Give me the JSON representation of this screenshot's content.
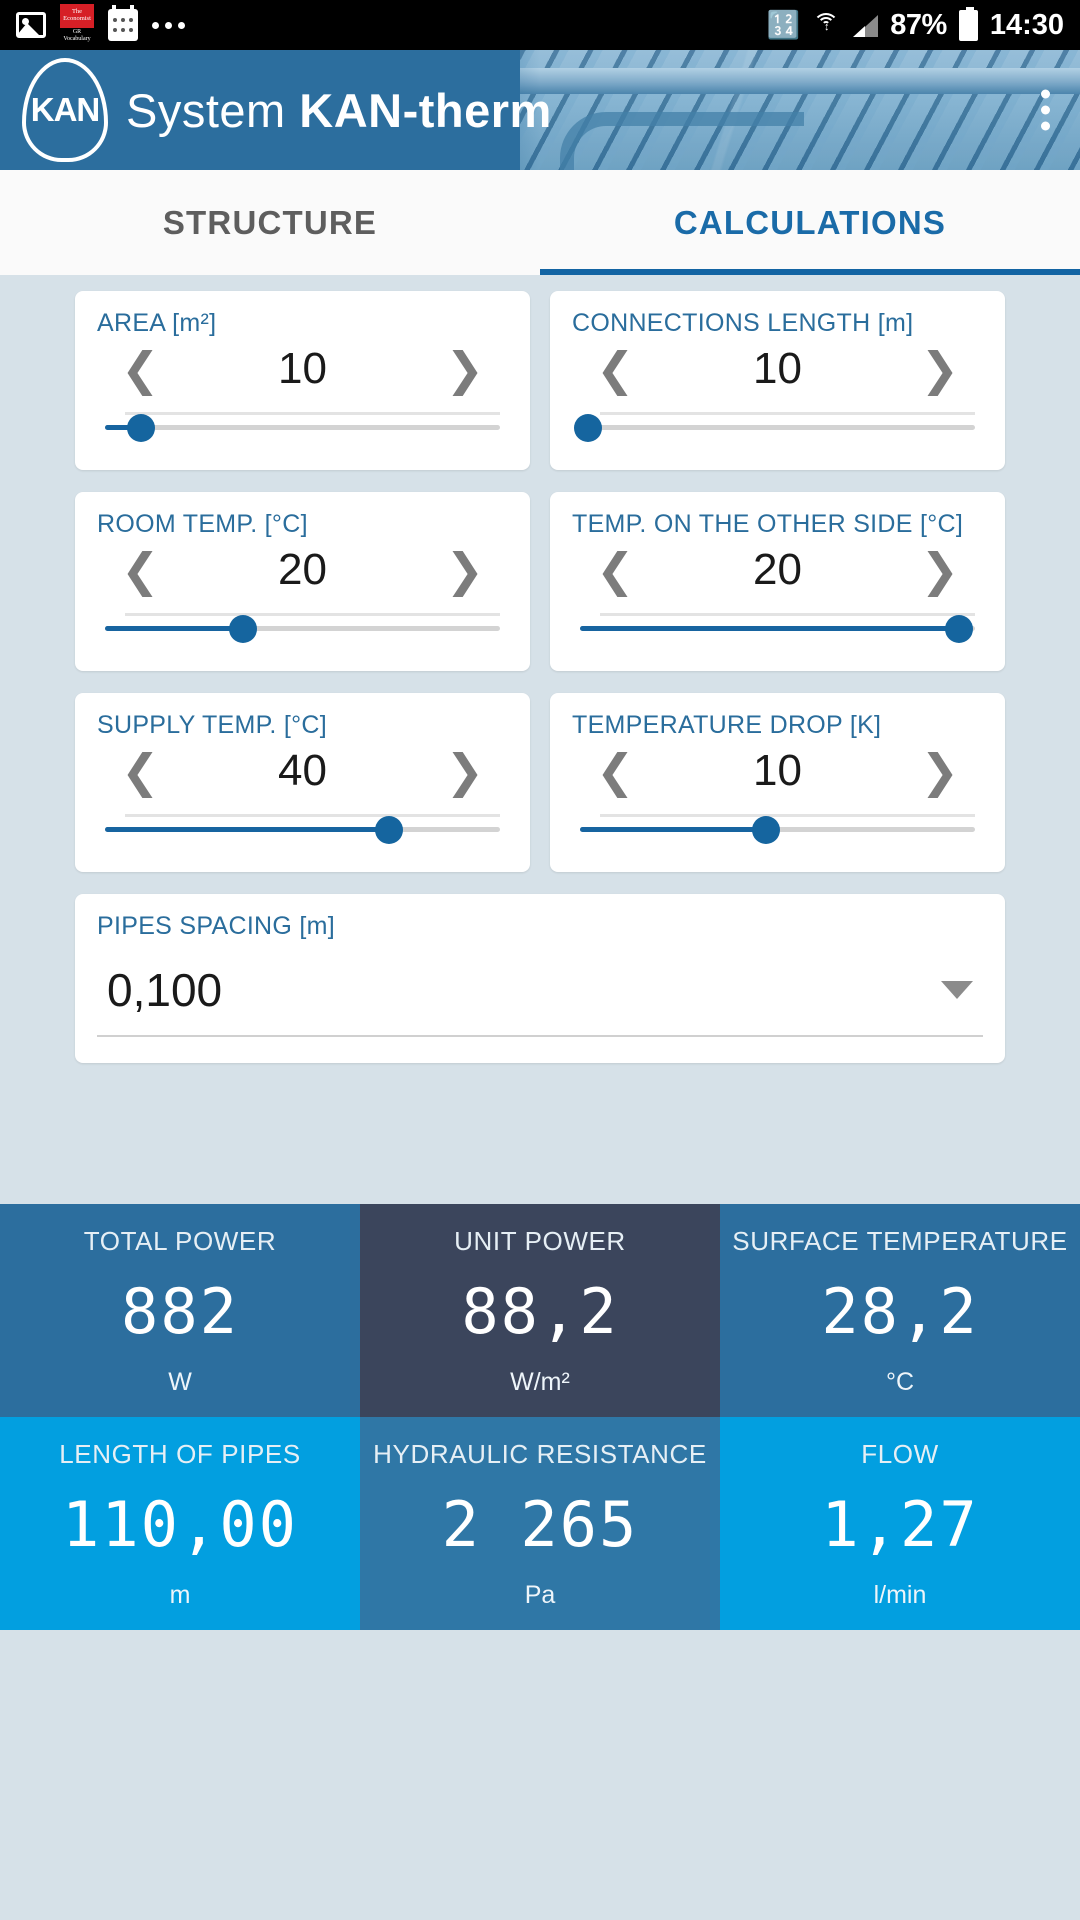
{
  "statusbar": {
    "notifications": [
      {
        "icon": "gallery-icon"
      },
      {
        "icon": "economist-icon",
        "line1": "The",
        "line2": "Economist",
        "sub1": "GR",
        "sub2": "Vocabulary"
      },
      {
        "icon": "calculator-icon"
      },
      {
        "icon": "more-notifications-icon"
      }
    ],
    "bluetooth_icon": "bluetooth-icon",
    "wifi_icon": "wifi-icon",
    "signal_icon": "cellular-signal-icon",
    "battery_percent": "87%",
    "battery_icon": "battery-full-icon",
    "time": "14:30"
  },
  "header": {
    "logo_text": "KAN",
    "title_light": "System ",
    "title_bold": "KAN-therm",
    "menu_icon": "overflow-menu-icon",
    "background": "#2c6e9e"
  },
  "tabs": [
    {
      "label": "STRUCTURE",
      "active": false
    },
    {
      "label": "CALCULATIONS",
      "active": true
    }
  ],
  "accent_color": "#1a6ba8",
  "fields": [
    {
      "label": "AREA [m²]",
      "value": "10",
      "prev_icon": "chevron-left-icon",
      "next_icon": "chevron-right-icon",
      "slider_percent": 9
    },
    {
      "label": "CONNECTIONS LENGTH [m]",
      "value": "10",
      "prev_icon": "chevron-left-icon",
      "next_icon": "chevron-right-icon",
      "slider_percent": 2
    },
    {
      "label": "ROOM TEMP. [°C]",
      "value": "20",
      "prev_icon": "chevron-left-icon",
      "next_icon": "chevron-right-icon",
      "slider_percent": 35
    },
    {
      "label": "TEMP. ON THE OTHER SIDE [°C]",
      "value": "20",
      "prev_icon": "chevron-left-icon",
      "next_icon": "chevron-right-icon",
      "slider_percent": 96
    },
    {
      "label": "SUPPLY TEMP. [°C]",
      "value": "40",
      "prev_icon": "chevron-left-icon",
      "next_icon": "chevron-right-icon",
      "slider_percent": 72
    },
    {
      "label": "TEMPERATURE DROP [K]",
      "value": "10",
      "prev_icon": "chevron-left-icon",
      "next_icon": "chevron-right-icon",
      "slider_percent": 47
    }
  ],
  "dropdown": {
    "label": "PIPES SPACING [m]",
    "value": "0,100",
    "arrow_icon": "dropdown-triangle-icon"
  },
  "results": [
    {
      "title": "TOTAL POWER",
      "value": "882",
      "unit": "W",
      "bg": "#2c6e9e"
    },
    {
      "title": "UNIT POWER",
      "value": "88,2",
      "unit": "W/m²",
      "bg": "#3b455c"
    },
    {
      "title": "SURFACE TEMPERATURE",
      "value": "28,2",
      "unit": "°C",
      "bg": "#2c6e9e"
    },
    {
      "title": "LENGTH OF PIPES",
      "value": "110,00",
      "unit": "m",
      "bg": "#029fe0"
    },
    {
      "title": "HYDRAULIC RESISTANCE",
      "value": "2 265",
      "unit": "Pa",
      "bg": "#2f77a6"
    },
    {
      "title": "FLOW",
      "value": "1,27",
      "unit": "l/min",
      "bg": "#029fe0"
    }
  ]
}
